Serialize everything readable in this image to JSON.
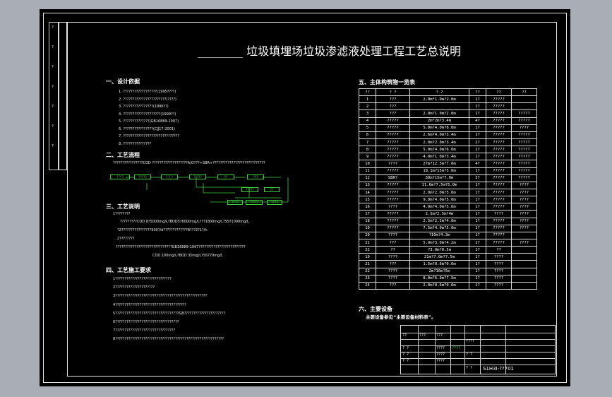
{
  "title": "________ 垃圾填埋场垃圾渗滤液处理工程工艺总说明",
  "section1": {
    "heading": "一、设计依据",
    "items": [
      "1. ??????????????????(1995????)",
      "2. ???????????????????????(????)",
      "3. ????????????????(1996??)",
      "4. ????????????????????(1999??)",
      "5. ??????????????(GB16889-1997)",
      "6. ????????????????(CJJ17-2001)",
      "7. ??????????????????????????????",
      "8. ???????????????"
    ]
  },
  "section2": {
    "heading": "二、工艺流程",
    "text": "????????????????COD ???????????????????A/O???+SBR+????????????????????????????",
    "boxes": [
      "? ? ?",
      "?????",
      "? ? ?",
      "?????",
      "??",
      "???",
      "?????",
      "??",
      "????",
      "?????",
      "????"
    ]
  },
  "section3": {
    "heading": "三、工艺说明",
    "lines": [
      "1????????",
      "?????????COD 8?5000mg/L?BOD5?6000mg/L???1800mg/L?SS?1000mg/L",
      "?2????????????????900?/d?????????????8???2?1?/h",
      "2????????",
      "??????????????????????????????GB16889-1997?????????????????????????",
      "COD 100mg/L?BOD 30mg/L?SS?70mg/L"
    ]
  },
  "section4": {
    "heading": "四、工艺施工要求",
    "lines": [
      "1??????????????????????????????",
      "2?????????????????????",
      "3?????????????????????????????????????????????????",
      "4??????????????????????????????????????",
      "5??????????????????????????????????GB??????????????????????",
      "6??????????????????????????????????",
      "7????????????????????????????????",
      "8??????????????????????????????????????????????????????????"
    ]
  },
  "section5": {
    "heading": "五、主体构筑物一览表",
    "columns": [
      "??",
      "? ?",
      "? ?",
      "??",
      "??",
      "??"
    ],
    "rows": [
      [
        "1",
        "???",
        "2.0m*1.0m?2.0m",
        "1?",
        "?????",
        ""
      ],
      [
        "2",
        "???",
        "",
        "1?",
        "?????",
        ""
      ],
      [
        "3",
        "???",
        "2.0m?1.0m?2.0m",
        "1?",
        "?????",
        "?????"
      ],
      [
        "4",
        "?????",
        "2m*2m?3.4m",
        "4?",
        "?????",
        "?????"
      ],
      [
        "5",
        "?????",
        "5.0m?4.0m?8.0m",
        "1?",
        "?????",
        "????"
      ],
      [
        "6",
        "?????",
        "2.6m?4.0m?3.4m",
        "1?",
        "?????",
        "?????"
      ],
      [
        "7",
        "?????",
        "2.0m?2.0m?3.4m",
        "2?",
        "?????",
        "?????"
      ],
      [
        "8",
        "?????",
        "5.0m?4.0m?6.0m",
        "1?",
        "?????",
        "?????"
      ],
      [
        "9",
        "?????",
        "4.0m?1.0m?3.4m",
        "1?",
        "?????",
        "?????"
      ],
      [
        "10",
        "????",
        "27m?12.5m?7.0m",
        "4?",
        "?????",
        "?????"
      ],
      [
        "11",
        "?????",
        "18.1m?15m?5.0m",
        "1?",
        "?????",
        "?????"
      ],
      [
        "12",
        "SBR?",
        "30m?15m?7.0m",
        "3?",
        "?????",
        "?????"
      ],
      [
        "13",
        "?????",
        "11.6m?7.5m?5.0m",
        "1?",
        "?????",
        "????"
      ],
      [
        "14",
        "?????",
        "2.0m?2.0m?5.0m",
        "1?",
        "?????",
        "????"
      ],
      [
        "15",
        "?????",
        "9.0m?4.0m?5.0m",
        "1?",
        "?????",
        "????"
      ],
      [
        "16",
        "????",
        "4.0m?4.0m?5.0m",
        "1?",
        "?????",
        "????"
      ],
      [
        "17",
        "?????",
        "2.5m?2.5m?4m",
        "1?",
        "????",
        "????"
      ],
      [
        "18",
        "?????",
        "2.5m?2.5m?4.0m",
        "1?",
        "?????",
        "????"
      ],
      [
        "19",
        "?????",
        "7.5m?4.0m?5.0m",
        "1?",
        "?????",
        "????"
      ],
      [
        "20",
        "????",
        "?10m?4.3m",
        "1?",
        "?????",
        ""
      ],
      [
        "21",
        "???",
        "5.0m?3.0m?4.2m",
        "1?",
        "?????",
        "????"
      ],
      [
        "22",
        "??",
        "?3.0m?0.5m",
        "1?",
        "??",
        ""
      ],
      [
        "19",
        "????",
        "21m?7.0m?7.5m",
        "1?",
        "????",
        ""
      ],
      [
        "21",
        "???",
        "1.5m?0.6m?0.6m",
        "1?",
        "????",
        ""
      ],
      [
        "22",
        "????",
        "2m?16m?5m",
        "1?",
        "????",
        ""
      ],
      [
        "23",
        "????",
        "8.0m?6.0m?7.5m",
        "1?",
        "????",
        ""
      ],
      [
        "24",
        "???",
        "2.0m?0.6m?0.6m",
        "1?",
        "????",
        ""
      ]
    ]
  },
  "section6": {
    "heading": "六、主要设备",
    "text": "主要设备参见“主要设备材料表”。"
  },
  "title_block": {
    "drawing_no": "S1H3I-??701",
    "cells": [
      "??",
      "???",
      "???",
      "????",
      "? ?",
      "????",
      "????",
      "? ?",
      "????",
      "? ?",
      "? ?",
      "????",
      "? ?"
    ]
  },
  "side_labels": [
    "?",
    "?",
    "?",
    "?",
    "?",
    "?",
    "?"
  ]
}
